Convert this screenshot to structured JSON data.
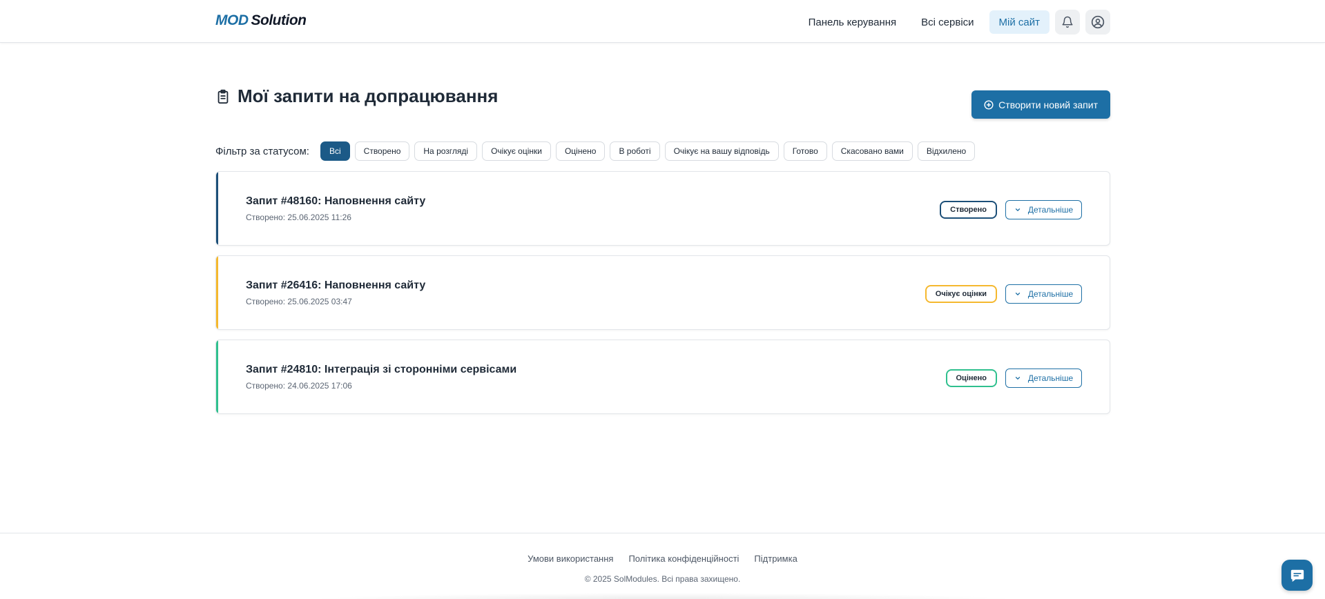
{
  "brand": {
    "logo_part1": "MOD",
    "logo_part2": "Solution",
    "primary_color": "#1d6fa5"
  },
  "nav": {
    "items": [
      {
        "label": "Панель керування",
        "active": false
      },
      {
        "label": "Всі сервіси",
        "active": false
      },
      {
        "label": "Мій сайт",
        "active": true
      }
    ],
    "icons": [
      "bell-icon",
      "user-circle-icon"
    ]
  },
  "page": {
    "title": "Мої запити на допрацювання",
    "title_icon": "clipboard-icon",
    "create_button": "Створити новий запит",
    "create_icon": "plus-circle-icon"
  },
  "filter": {
    "label": "Фільтр за статусом:",
    "options": [
      {
        "label": "Всі",
        "active": true
      },
      {
        "label": "Створено",
        "active": false
      },
      {
        "label": "На розгляді",
        "active": false
      },
      {
        "label": "Очікує оцінки",
        "active": false
      },
      {
        "label": "Оцінено",
        "active": false
      },
      {
        "label": "В роботі",
        "active": false
      },
      {
        "label": "Очікує на вашу відповідь",
        "active": false
      },
      {
        "label": "Готово",
        "active": false
      },
      {
        "label": "Скасовано вами",
        "active": false
      },
      {
        "label": "Відхилено",
        "active": false
      }
    ]
  },
  "requests": [
    {
      "title": "Запит #48160: Наповнення сайту",
      "date": "Створено: 25.06.2025 11:26",
      "status": "Створено",
      "color": "#1c4f78",
      "details": "Детальніше"
    },
    {
      "title": "Запит #26416: Наповнення сайту",
      "date": "Створено: 25.06.2025 03:47",
      "status": "Очікує оцінки",
      "color": "#f5b82e",
      "details": "Детальніше"
    },
    {
      "title": "Запит #24810: Інтеграція зі сторонніми сервісами",
      "date": "Створено: 24.06.2025 17:06",
      "status": "Оцінено",
      "color": "#2fc08e",
      "details": "Детальніше"
    }
  ],
  "footer": {
    "links": [
      "Умови використання",
      "Політика конфіденційності",
      "Підтримка"
    ],
    "copyright": "© 2025 SolModules. Всі права захищено."
  },
  "chat": {
    "icon": "chat-bubble-icon"
  }
}
